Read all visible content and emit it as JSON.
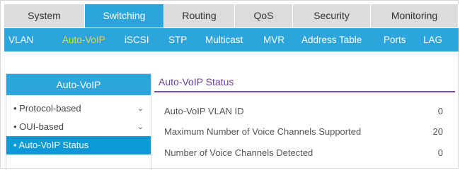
{
  "top_nav": {
    "tabs": [
      {
        "label": "System"
      },
      {
        "label": "Switching"
      },
      {
        "label": "Routing"
      },
      {
        "label": "QoS"
      },
      {
        "label": "Security"
      },
      {
        "label": "Monitoring"
      }
    ],
    "active": "Switching"
  },
  "sub_nav": {
    "items": [
      "VLAN",
      "Auto-VoIP",
      "iSCSI",
      "STP",
      "Multicast",
      "MVR",
      "Address Table",
      "Ports",
      "LAG"
    ],
    "active": "Auto-VoIP"
  },
  "sidebar": {
    "title": "Auto-VoIP",
    "items": [
      {
        "label": "Protocol-based"
      },
      {
        "label": "OUI-based"
      },
      {
        "label": "Auto-VoIP Status"
      }
    ],
    "selected": "Auto-VoIP Status"
  },
  "content": {
    "tab_title": "Auto-VoIP Status",
    "fields": [
      {
        "label": "Auto-VoIP VLAN ID",
        "value": "0"
      },
      {
        "label": "Maximum Number of Voice Channels Supported",
        "value": "20"
      },
      {
        "label": "Number of Voice Channels Detected",
        "value": "0"
      }
    ]
  },
  "colors": {
    "accent": "#2ca5dc",
    "selected": "#0b9ad7",
    "active_sub": "#f1d33a",
    "content_title": "#6a3d9a"
  }
}
